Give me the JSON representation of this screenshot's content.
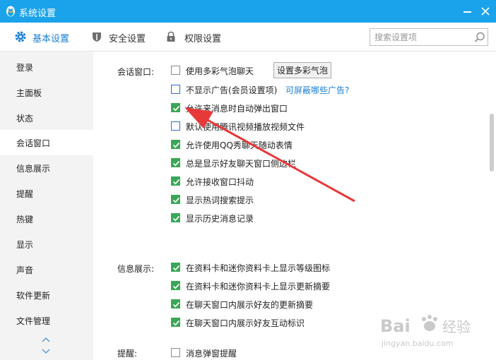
{
  "window": {
    "title": "系统设置"
  },
  "nav": {
    "tabs": [
      {
        "label": "基本设置"
      },
      {
        "label": "安全设置"
      },
      {
        "label": "权限设置"
      }
    ],
    "search_placeholder": "搜索设置项"
  },
  "sidebar": {
    "items": [
      {
        "label": "登录"
      },
      {
        "label": "主面板"
      },
      {
        "label": "状态"
      },
      {
        "label": "会话窗口"
      },
      {
        "label": "信息展示"
      },
      {
        "label": "提醒"
      },
      {
        "label": "热键"
      },
      {
        "label": "显示"
      },
      {
        "label": "声音"
      },
      {
        "label": "软件更新"
      },
      {
        "label": "文件管理"
      }
    ],
    "active_index": 3
  },
  "session": {
    "label": "会话窗口:",
    "bubble_button": "设置多彩气泡",
    "ad_link": "可屏蔽哪些广告?",
    "options": [
      {
        "label": "使用多彩气泡聊天",
        "checked": false
      },
      {
        "label": "不显示广告(会员设置项)",
        "checked": false
      },
      {
        "label": "允许来消息时自动弹出窗口",
        "checked": true
      },
      {
        "label": "默认使用腾讯视频播放视频文件",
        "checked": false
      },
      {
        "label": "允许使用QQ秀聊天随动表情",
        "checked": true
      },
      {
        "label": "总是显示好友聊天窗口侧边栏",
        "checked": true
      },
      {
        "label": "允许接收窗口抖动",
        "checked": true
      },
      {
        "label": "显示热词搜索提示",
        "checked": true
      },
      {
        "label": "显示历史消息记录",
        "checked": true
      }
    ]
  },
  "info": {
    "label": "信息展示:",
    "options": [
      {
        "label": "在资料卡和迷你资料卡上显示等级图标",
        "checked": true
      },
      {
        "label": "在资料卡和迷你资料卡上显示更新摘要",
        "checked": true
      },
      {
        "label": "在聊天窗口内展示好友的更新摘要",
        "checked": true
      },
      {
        "label": "在聊天窗口内展示好友互动标识",
        "checked": true
      }
    ]
  },
  "remind": {
    "label": "提醒:",
    "options": [
      {
        "label": "消息弹窗提醒",
        "checked": false
      }
    ]
  },
  "colors": {
    "titlebar": "#1aa3ea",
    "accent": "#1b7fd4",
    "check": "#3aa757",
    "arrow": "#e8393a"
  },
  "watermark": {
    "brand": "Bai",
    "brand_suffix": "经验",
    "url": "jingyan.baidu.com"
  }
}
